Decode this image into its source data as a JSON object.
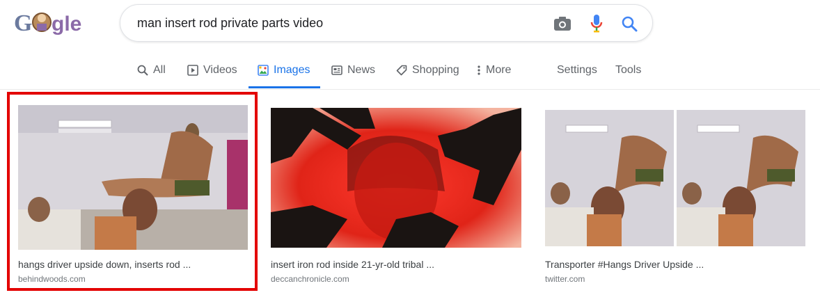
{
  "logo": {
    "text": "Google"
  },
  "search": {
    "query": "man insert rod private parts video"
  },
  "tabs": [
    {
      "label": "All",
      "icon": "search-icon"
    },
    {
      "label": "Videos",
      "icon": "play-icon"
    },
    {
      "label": "Images",
      "icon": "image-icon",
      "active": true
    },
    {
      "label": "News",
      "icon": "newspaper-icon"
    },
    {
      "label": "Shopping",
      "icon": "tag-icon"
    },
    {
      "label": "More",
      "icon": "more-vert-icon"
    }
  ],
  "tools": {
    "settings": "Settings",
    "tools": "Tools"
  },
  "results": [
    {
      "caption": "hangs driver upside down, inserts rod ...",
      "domain": "behindwoods.com",
      "highlighted": true
    },
    {
      "caption": "insert iron rod inside 21-yr-old tribal ...",
      "domain": "deccanchronicle.com"
    },
    {
      "caption": "Transporter #Hangs Driver Upside ...",
      "domain": "twitter.com"
    }
  ],
  "colors": {
    "accent": "#1a73e8",
    "highlight": "#e30000"
  }
}
